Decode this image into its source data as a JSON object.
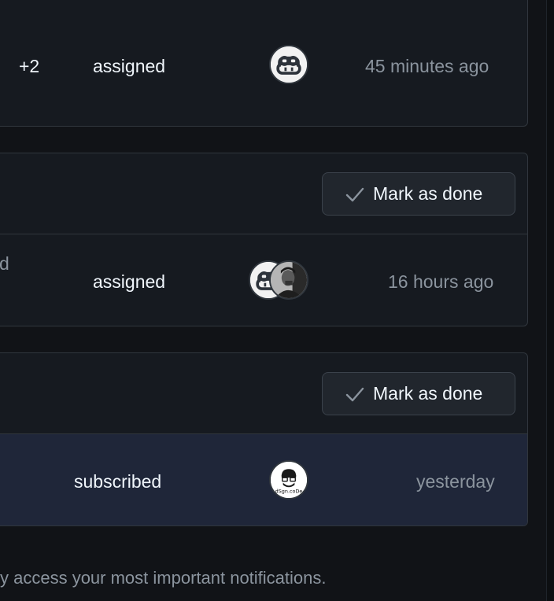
{
  "notifications": [
    {
      "count": "+2",
      "reason": "assigned",
      "time": "45 minutes ago",
      "avatars": [
        "copilot-avatar"
      ]
    },
    {
      "mark_done_label": "Mark as done",
      "title_fragment": "d",
      "reason": "assigned",
      "time": "16 hours ago",
      "avatars": [
        "copilot-avatar",
        "user-photo-avatar"
      ]
    },
    {
      "mark_done_label": "Mark as done",
      "reason": "subscribed",
      "time": "yesterday",
      "avatars": [
        "dsgn-code-avatar"
      ],
      "avatar_text": "dSgn.coDe"
    }
  ],
  "footer": {
    "text": "y access your most important notifications."
  },
  "colors": {
    "background": "#111317",
    "panel": "#161a20",
    "highlight_row": "#1f2639",
    "border": "#30363d",
    "muted_text": "#8b949e"
  }
}
